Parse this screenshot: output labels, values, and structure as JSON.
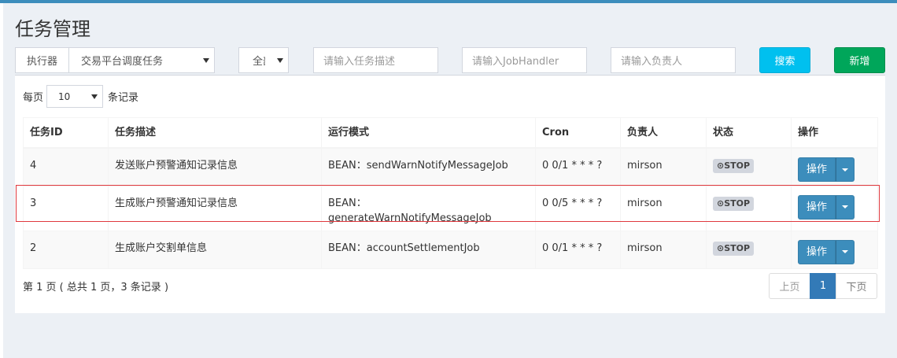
{
  "page": {
    "title": "任务管理"
  },
  "filters": {
    "executor_label": "执行器",
    "executor_value": "交易平台调度任务",
    "status_value": "全部",
    "job_desc_placeholder": "请输入任务描述",
    "job_handler_placeholder": "请输入JobHandler",
    "author_placeholder": "请输入负责人",
    "search_label": "搜索",
    "add_label": "新增"
  },
  "length": {
    "prefix": "每页",
    "value": "10",
    "suffix": "条记录"
  },
  "table": {
    "headers": [
      "任务ID",
      "任务描述",
      "运行模式",
      "Cron",
      "负责人",
      "状态",
      "操作"
    ],
    "rows": [
      {
        "id": "4",
        "desc": "发送账户预警通知记录信息",
        "mode": "BEAN：sendWarnNotifyMessageJob",
        "cron": "0 0/1 * * * ?",
        "author": "mirson",
        "status": "⊙STOP",
        "action": "操作"
      },
      {
        "id": "3",
        "desc": "生成账户预警通知记录信息",
        "mode_line1": "BEAN：",
        "mode_line2": "generateWarnNotifyMessageJob",
        "cron": "0 0/5 * * * ?",
        "author": "mirson",
        "status": "⊙STOP",
        "action": "操作"
      },
      {
        "id": "2",
        "desc": "生成账户交割单信息",
        "mode": "BEAN：accountSettlementJob",
        "cron": "0 0/1 * * * ?",
        "author": "mirson",
        "status": "⊙STOP",
        "action": "操作"
      }
    ]
  },
  "footer": {
    "info": "第 1 页 ( 总共 1 页，3 条记录 )",
    "prev": "上页",
    "current": "1",
    "next": "下页"
  },
  "colors": {
    "primary": "#3c8dbc",
    "info": "#00c0ef",
    "success": "#00a65a",
    "highlight_border": "#e0393e"
  }
}
